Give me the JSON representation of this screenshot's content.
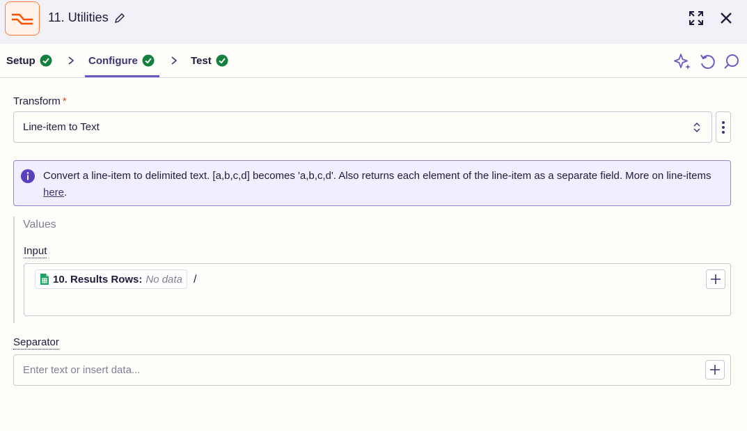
{
  "header": {
    "step_title": "11. Utilities",
    "app_icon": "formatter-icon",
    "accent": "#ff4f00"
  },
  "tabs": [
    {
      "label": "Setup",
      "status": "complete"
    },
    {
      "label": "Configure",
      "status": "complete",
      "active": true
    },
    {
      "label": "Test",
      "status": "complete"
    }
  ],
  "toolbar": {
    "icons": [
      "ai-sparkle-icon",
      "undo-icon",
      "comment-icon"
    ]
  },
  "transform": {
    "label": "Transform",
    "required_marker": "*",
    "selected": "Line-item to Text"
  },
  "info": {
    "text": "Convert a line-item to delimited text. [a,b,c,d] becomes 'a,b,c,d'. Also returns each element of the line-item as a separate field. More on line-items ",
    "link_text": "here",
    "suffix": "."
  },
  "values": {
    "title": "Values",
    "input": {
      "label": "Input",
      "pill_label": "10. Results Rows:",
      "pill_value": "No data",
      "trailing_text": "/"
    }
  },
  "separator": {
    "label": "Separator",
    "placeholder": "Enter text or insert data...",
    "value": ""
  },
  "colors": {
    "success": "#13803d",
    "primary": "#6a5ac8",
    "info_bg": "#f1efff"
  }
}
